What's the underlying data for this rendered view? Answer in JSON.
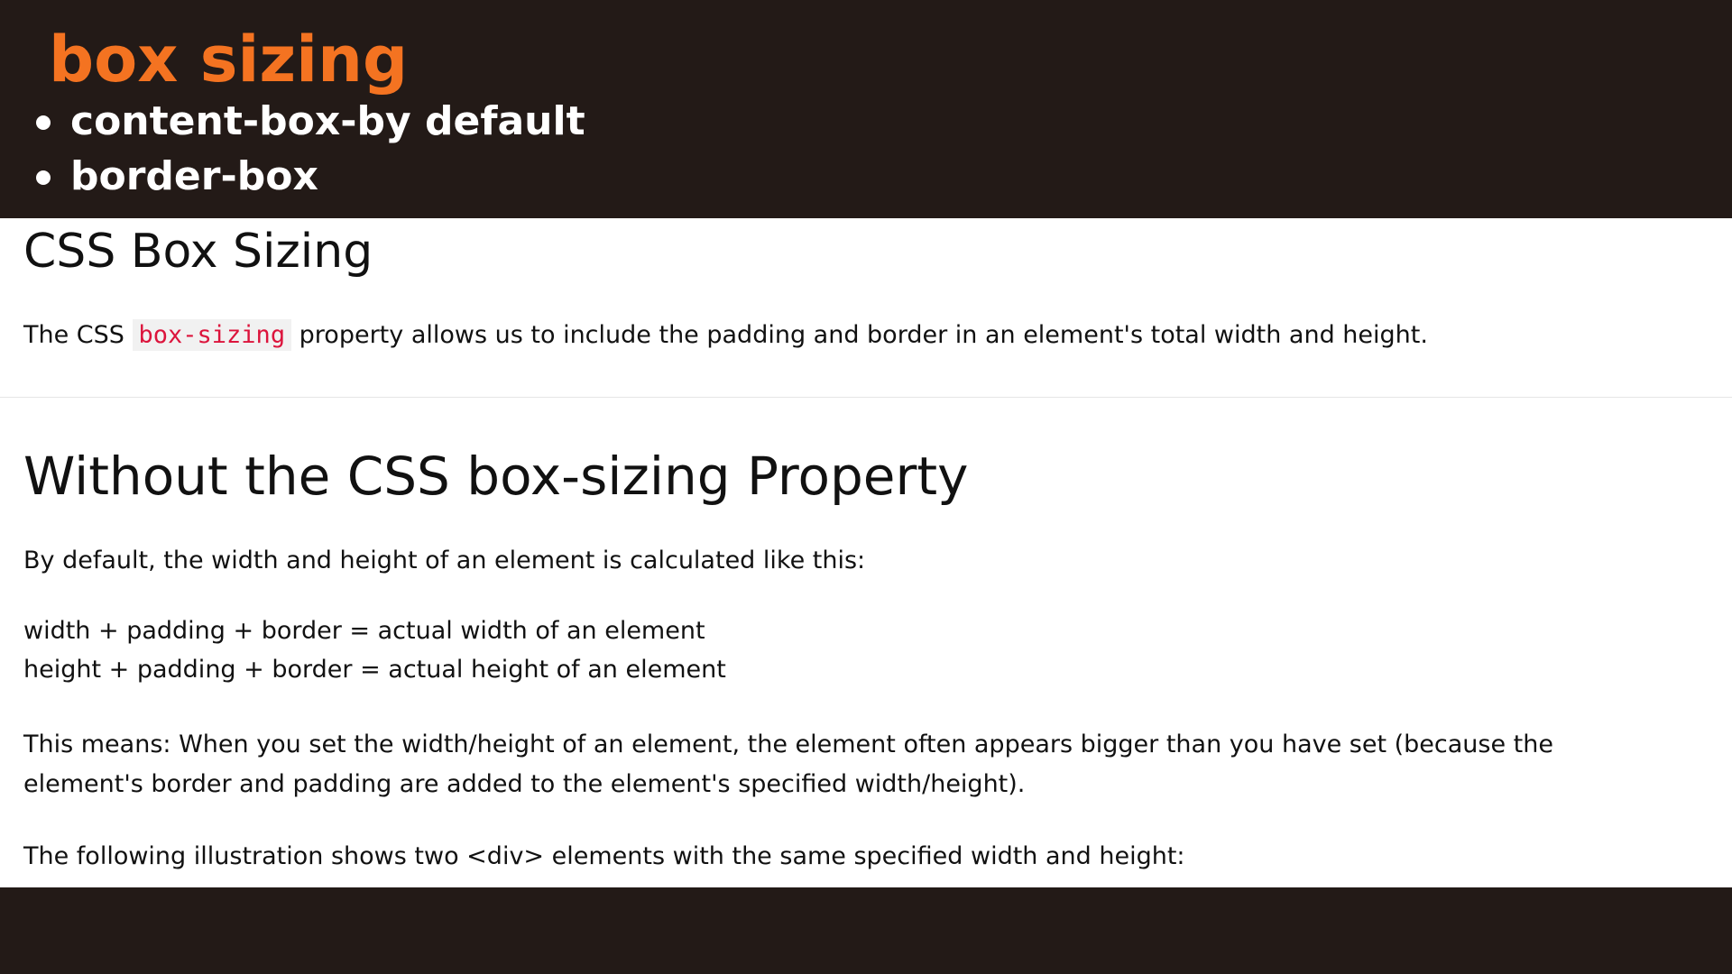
{
  "slide": {
    "title": "box sizing",
    "bullets": [
      "content-box-by default",
      "border-box"
    ]
  },
  "article": {
    "title": "CSS Box Sizing",
    "intro": {
      "before": "The CSS ",
      "code": "box-sizing",
      "after": " property allows us to include the padding and border in an element's total width and height."
    },
    "section_title": "Without the CSS box-sizing Property",
    "default_text": "By default, the width and height of an element is calculated like this:",
    "formula_width": "width + padding + border = actual width of an element",
    "formula_height": "height + padding + border = actual height of an element",
    "means_line1": "This means: When you set the width/height of an element, the element often appears bigger than you have set (because the",
    "means_line2": "element's border and padding are added to the element's specified width/height).",
    "illustration_text": "The following illustration shows two <div> elements with the same specified width and height:"
  },
  "colors": {
    "banner_background": "#231a17",
    "title_accent": "#f47321",
    "code_text": "#dc143c",
    "code_background": "#f1f1f1"
  }
}
